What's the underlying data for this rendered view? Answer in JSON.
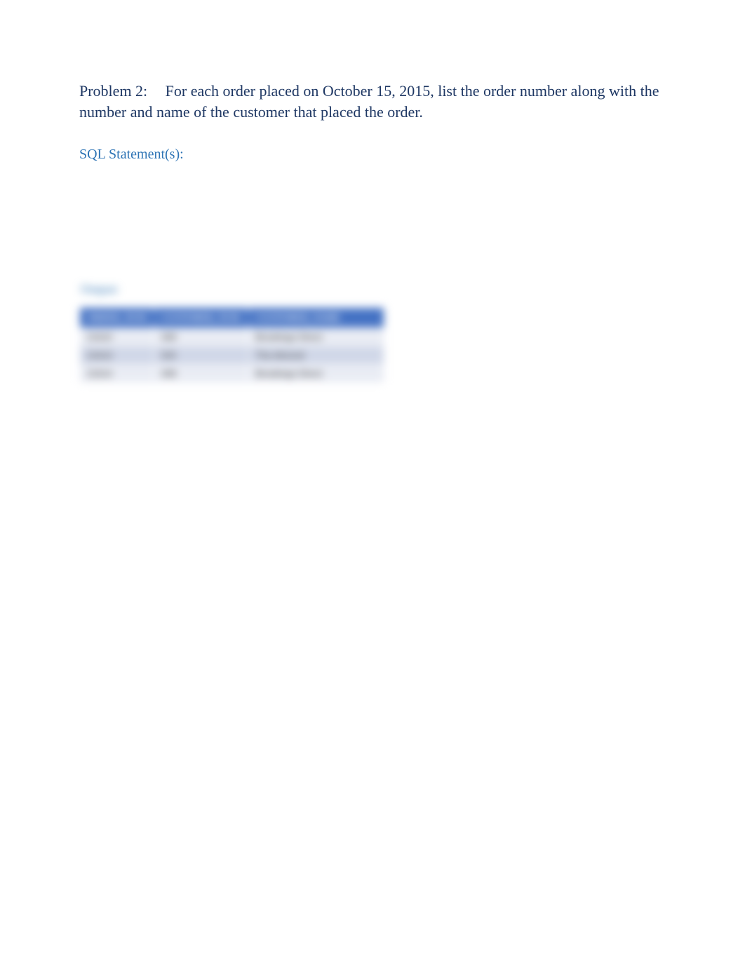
{
  "problem": {
    "label": "Problem 2:",
    "text": "For each order placed on October 15, 2015, list the order number along with the number and name of the customer that placed the order."
  },
  "sql_label": "SQL Statement(s):",
  "output_label": "Output:",
  "table": {
    "headers": [
      "ORDER_NUM",
      "CUSTOMER_NUM",
      "CUSTOMER_NAME"
    ],
    "rows": [
      [
        "21610",
        "408",
        "Brookings Direct"
      ],
      [
        "21613",
        "525",
        "The Almond"
      ],
      [
        "21614",
        "408",
        "Brookings Direct"
      ]
    ]
  }
}
